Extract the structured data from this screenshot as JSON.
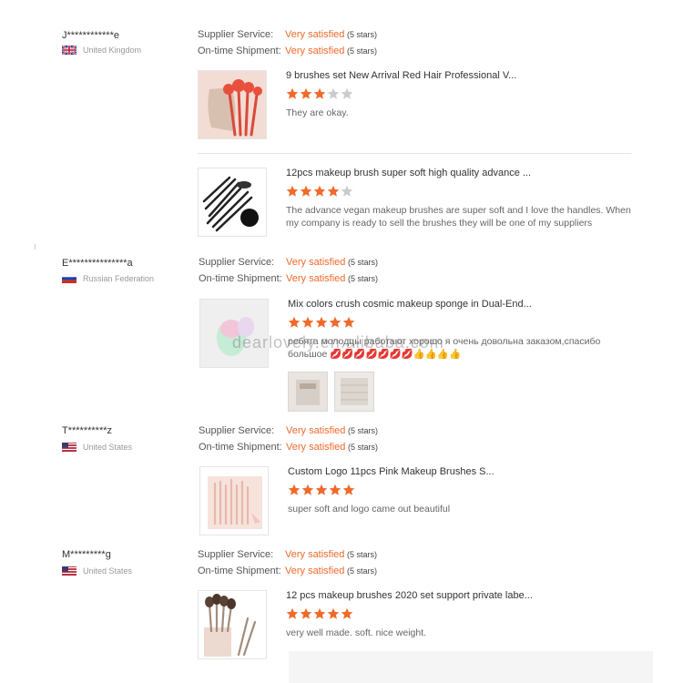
{
  "colors": {
    "accent": "#ef6a2b",
    "star_filled": "#ef6a2b",
    "star_empty": "#cccccc"
  },
  "labels": {
    "supplier_service": "Supplier Service:",
    "on_time_shipment": "On-time Shipment:"
  },
  "watermark": "dearlovely.en.alibaba.com",
  "reviews": [
    {
      "user": "J************e",
      "country": "United Kingdom",
      "flag": "uk",
      "supplier_service": "Very satisfied",
      "supplier_stars": "(5 stars)",
      "shipment": "Very satisfied",
      "shipment_stars": "(5 stars)",
      "items": [
        {
          "title": "9 brushes set New Arrival Red Hair Professional V...",
          "rating": 3,
          "text": "They are okay.",
          "image": "red-brush-set"
        },
        {
          "title": "12pcs makeup brush super soft high quality advance ...",
          "rating": 4,
          "text": "The advance vegan makeup brushes are super soft and I love the handles. When my company is ready to sell the brushes they will be one of my suppliers",
          "image": "black-brush-set"
        }
      ]
    },
    {
      "user": "E***************a",
      "country": "Russian Federation",
      "flag": "ru",
      "supplier_service": "Very satisfied",
      "supplier_stars": "(5 stars)",
      "shipment": "Very satisfied",
      "shipment_stars": "(5 stars)",
      "items": [
        {
          "title": "Mix colors crush cosmic makeup sponge in Dual-End...",
          "rating": 5,
          "text": "ребята молодцы работают хорошо я очень довольна заказом,спасибо большое 💋💋💋💋💋💋💋👍👍👍👍",
          "image": "makeup-sponges"
        }
      ]
    },
    {
      "user": "T**********z",
      "country": "United States",
      "flag": "us",
      "supplier_service": "Very satisfied",
      "supplier_stars": "(5 stars)",
      "shipment": "Very satisfied",
      "shipment_stars": "(5 stars)",
      "items": [
        {
          "title": "Custom Logo 11pcs Pink Makeup Brushes S...",
          "rating": 5,
          "text": "super soft and logo came out beautiful",
          "image": "pink-brush-set"
        }
      ]
    },
    {
      "user": "M*********g",
      "country": "United States",
      "flag": "us",
      "supplier_service": "Very satisfied",
      "supplier_stars": "(5 stars)",
      "shipment": "Very satisfied",
      "shipment_stars": "(5 stars)",
      "items": [
        {
          "title": "12 pcs makeup brushes 2020 set support private labe...",
          "rating": 5,
          "text": "very well made. soft. nice weight.",
          "image": "brown-brush-set"
        }
      ]
    }
  ]
}
